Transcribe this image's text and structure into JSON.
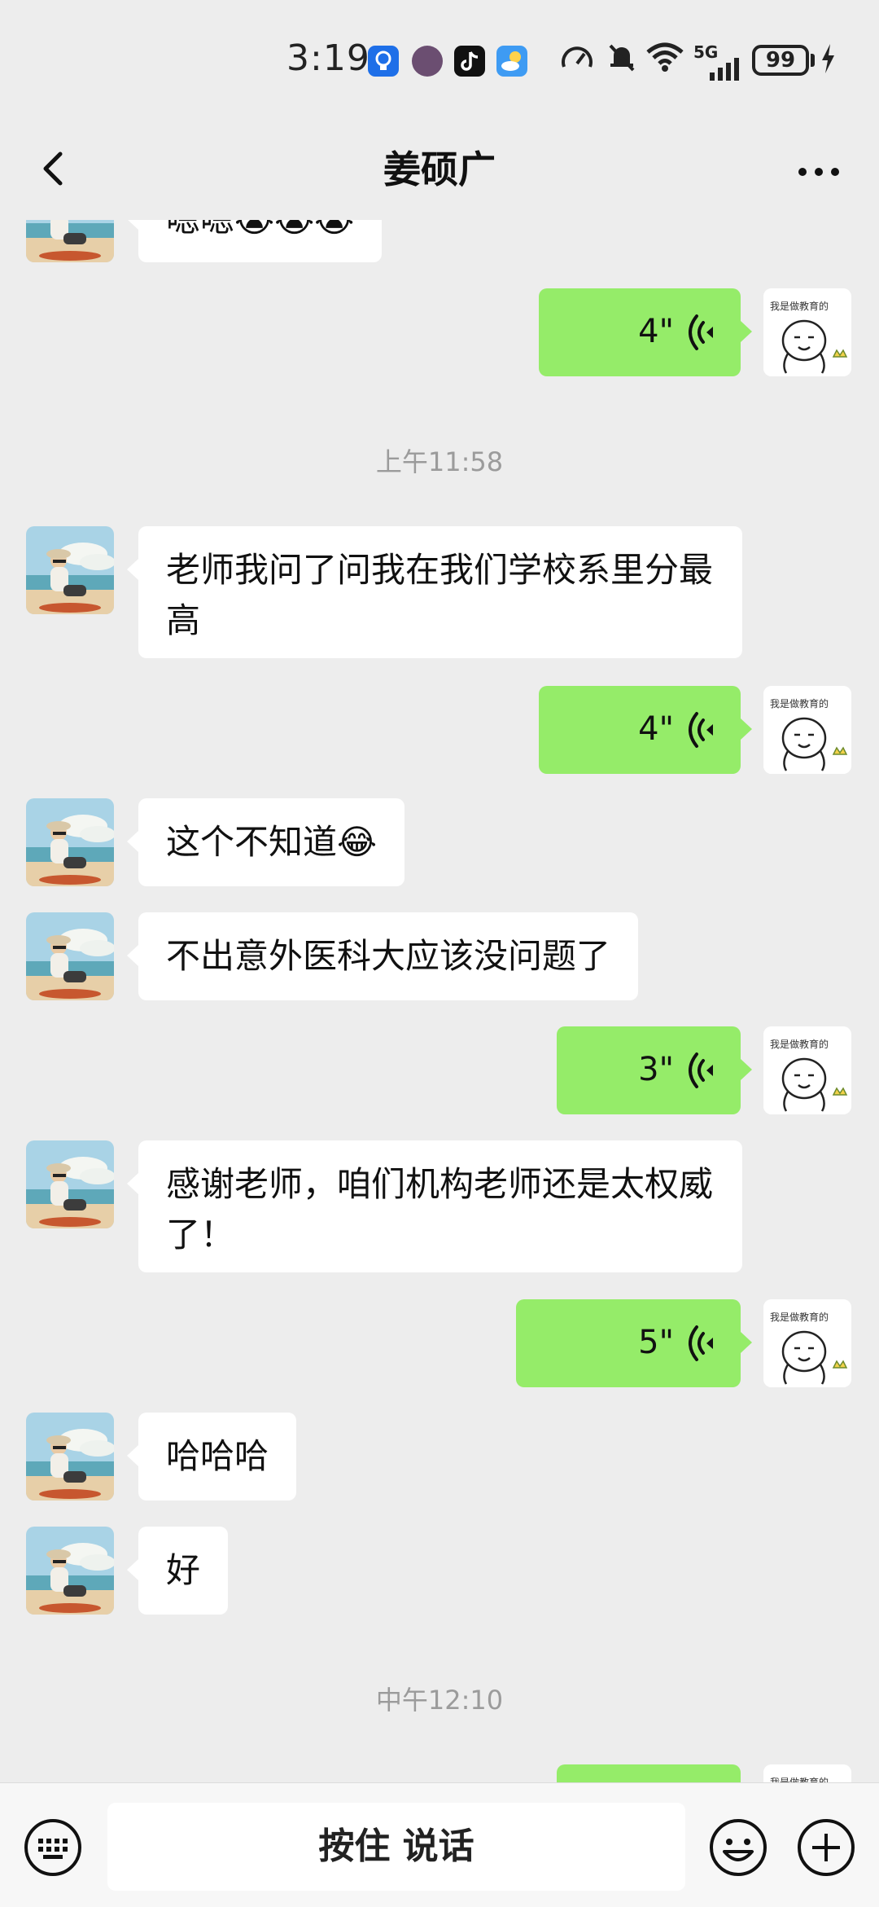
{
  "status_bar": {
    "time": "3:19",
    "network": "5G",
    "battery": "99"
  },
  "nav": {
    "title": "姜硕广"
  },
  "messages": {
    "m0": "嗯嗯😭😭😭",
    "m1_duration": "4\"",
    "ts1": "上午11:58",
    "m2": "老师我问了问我在我们学校系里分最高",
    "m3_duration": "4\"",
    "m4": "这个不知道😂",
    "m5": "不出意外医科大应该没问题了",
    "m6_duration": "3\"",
    "m7": "感谢老师，咱们机构老师还是太权威了！",
    "m8_duration": "5\"",
    "m9": "哈哈哈",
    "m10": "好",
    "ts2": "中午12:10"
  },
  "input_bar": {
    "hold_to_talk": "按住 说话"
  },
  "colors": {
    "outgoing_bubble": "#95EC69",
    "incoming_bubble": "#FFFFFF",
    "background": "#EDEDED"
  },
  "icons": [
    "back-icon",
    "more-icon",
    "voice-icon",
    "keyboard-icon",
    "emoji-icon",
    "plus-icon"
  ]
}
